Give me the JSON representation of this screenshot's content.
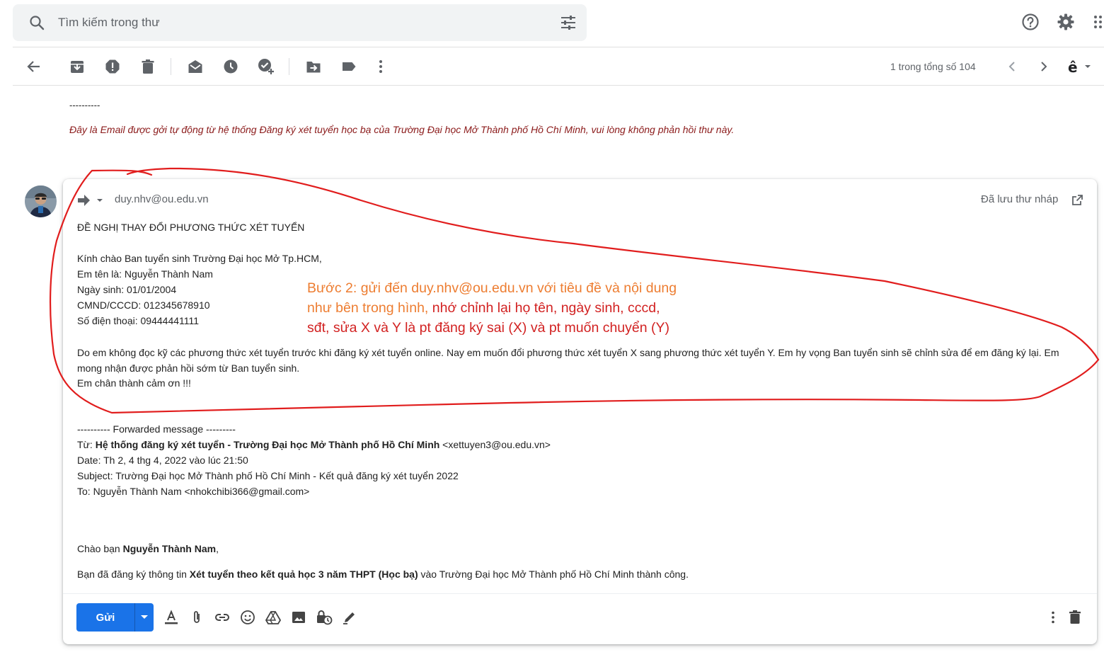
{
  "search": {
    "placeholder": "Tìm kiếm trong thư"
  },
  "toolbar": {
    "counter": "1 trong tổng số 104"
  },
  "previous": {
    "dashes": "----------",
    "auto_note": "Đây là Email được gởi tự động từ hệ thống Đăng ký xét tuyển học bạ của Trường Đại học Mở Thành phố Hồ Chí Minh, vui lòng không phản hồi thư này."
  },
  "compose": {
    "recipient": "duy.nhv@ou.edu.vn",
    "saved_status": "Đã lưu thư nháp",
    "subject": "ĐỀ NGHỊ THAY ĐỔI PHƯƠNG THỨC XÉT TUYỂN",
    "greeting": "Kính chào Ban tuyển sinh Trường Đại học Mở Tp.HCM,",
    "name_line": "Em tên là: Nguyễn Thành Nam",
    "dob_line": "Ngày sinh: 01/01/2004",
    "id_line": "CMND/CCCD: 012345678910",
    "phone_line": "Số điện thoại: 09444441111",
    "request": "Do em không đọc kỹ các phương thức xét tuyển trước khi đăng ký xét tuyển online. Nay em muốn đổi phương thức xét tuyển X sang phương thức xét tuyển Y. Em hy vọng Ban tuyển sinh sẽ chỉnh sửa để em đăng ký lại. Em mong nhận được phản hồi sớm từ Ban tuyển sinh.",
    "thanks": "Em chân thành cảm ơn !!!",
    "forwarded": {
      "header": "---------- Forwarded message ---------",
      "from_label": "Từ: ",
      "from_name": "Hệ thống đăng ký xét tuyển - Trường Đại học Mở Thành phố Hồ Chí Minh",
      "from_email": " <xettuyen3@ou.edu.vn>",
      "date_line": "Date: Th 2, 4 thg 4, 2022 vào lúc 21:50",
      "subject_line": "Subject: Trường Đại học Mở Thành phố Hồ Chí Minh - Kết quả đăng ký xét tuyển 2022",
      "to_line": "To: Nguyễn Thành Nam <nhokchibi366@gmail.com>",
      "hello_prefix": "Chào bạn ",
      "hello_name": "Nguyễn Thành Nam",
      "hello_suffix": ",",
      "reg_prefix": "Bạn đã đăng ký thông tin ",
      "reg_method": "Xét tuyển theo kết quả học 3 năm THPT (Học bạ)",
      "reg_suffix": " vào Trường Đại học Mở Thành phố Hồ Chí Minh thành công."
    },
    "send_label": "Gửi"
  },
  "annotation": {
    "line1": "Bước 2: gửi đến duy.nhv@ou.edu.vn với tiêu đề và nội dung",
    "line2_orange": "như bên trong hình, ",
    "line2_red": "nhớ chỉnh lại họ tên, ngày sinh, cccd,",
    "line3": "sđt, sửa X và Y là pt đăng ký sai (X) và pt muốn chuyển (Y)"
  },
  "colors": {
    "send_button": "#1a73e8",
    "annotation_orange": "#ed7d31",
    "annotation_red": "#d22222",
    "auto_note": "#8b1a1a"
  },
  "icons": [
    "search-icon",
    "filter-icon",
    "help-icon",
    "settings-icon",
    "back-icon",
    "archive-icon",
    "spam-icon",
    "delete-icon",
    "mark-unread-icon",
    "snooze-icon",
    "add-task-icon",
    "move-to-icon",
    "label-icon",
    "more-icon",
    "prev-icon",
    "next-icon",
    "input-tools-icon",
    "forward-icon",
    "popout-icon",
    "format-text-icon",
    "attach-icon",
    "link-icon",
    "emoji-icon",
    "drive-icon",
    "photo-icon",
    "confidential-icon",
    "signature-icon",
    "discard-icon"
  ]
}
